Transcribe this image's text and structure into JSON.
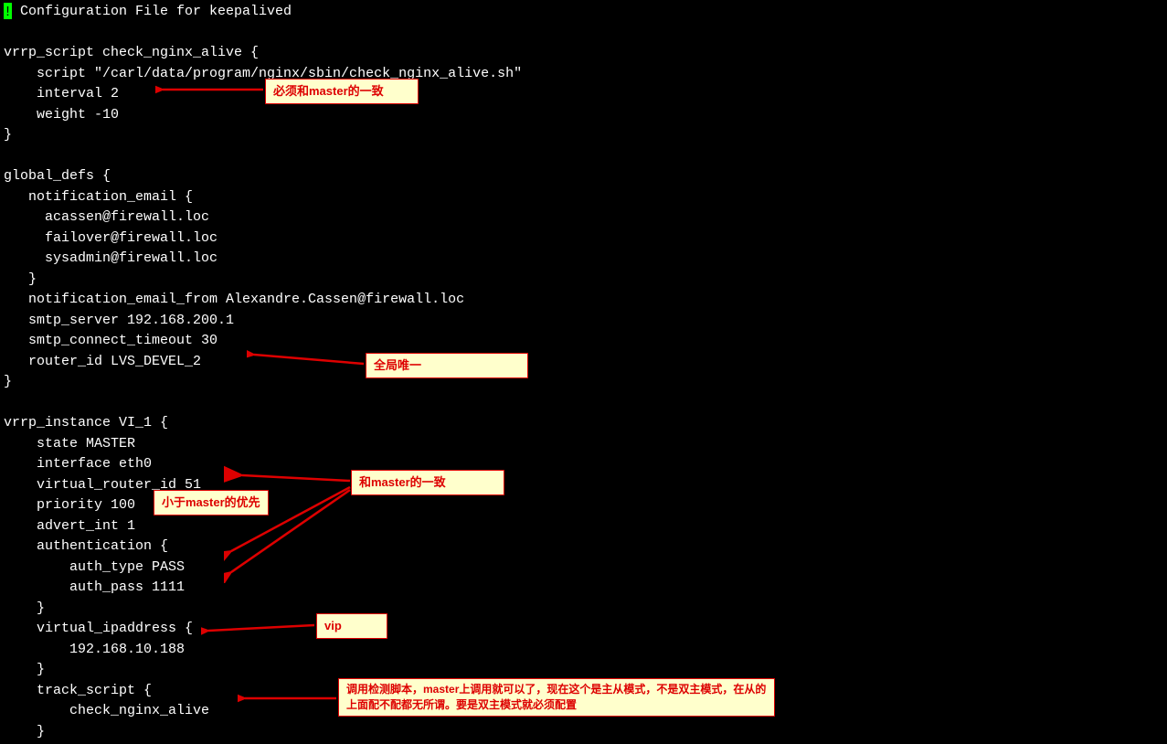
{
  "config": {
    "line0_prefix": " Configuration File for keepalived",
    "line1": "",
    "line2": "vrrp_script check_nginx_alive {",
    "line3": "    script \"/carl/data/program/nginx/sbin/check_nginx_alive.sh\"",
    "line4": "    interval 2",
    "line5": "    weight -10",
    "line6": "}",
    "line7": "",
    "line8": "global_defs {",
    "line9": "   notification_email {",
    "line10": "     acassen@firewall.loc",
    "line11": "     failover@firewall.loc",
    "line12": "     sysadmin@firewall.loc",
    "line13": "   }",
    "line14": "   notification_email_from Alexandre.Cassen@firewall.loc",
    "line15": "   smtp_server 192.168.200.1",
    "line16": "   smtp_connect_timeout 30",
    "line17": "   router_id LVS_DEVEL_2",
    "line18": "}",
    "line19": "",
    "line20": "vrrp_instance VI_1 {",
    "line21": "    state MASTER",
    "line22": "    interface eth0",
    "line23": "    virtual_router_id 51",
    "line24": "    priority 100",
    "line25": "    advert_int 1",
    "line26": "    authentication {",
    "line27": "        auth_type PASS",
    "line28": "        auth_pass 1111",
    "line29": "    }",
    "line30": "    virtual_ipaddress {",
    "line31": "        192.168.10.188",
    "line32": "    }",
    "line33": "    track_script {",
    "line34": "        check_nginx_alive",
    "line35": "    }"
  },
  "annotations": {
    "a1": "必须和master的一致",
    "a2": "全局唯一",
    "a3": "和master的一致",
    "a4": "小于master的优先",
    "a5": "vip",
    "a6": "调用检测脚本，master上调用就可以了，现在这个是主从模式，不是双主模式，在从的上面配不配都无所谓。要是双主模式就必须配置"
  }
}
